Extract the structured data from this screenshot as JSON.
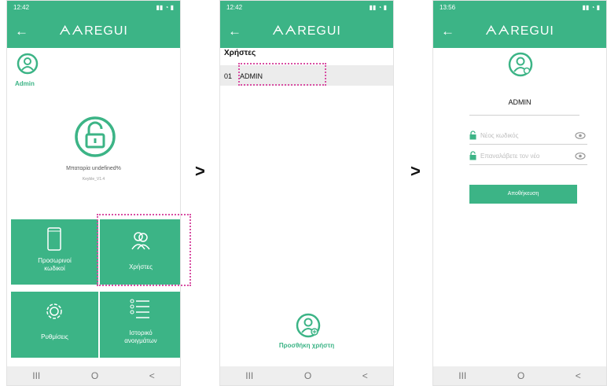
{
  "app": {
    "title": "ᗅᗅREGUI",
    "back_glyph": "←",
    "status_time_1": "12:42",
    "status_time_2": "12:42",
    "status_time_3": "13:56"
  },
  "step_arrows": [
    ">",
    ">"
  ],
  "screen1": {
    "user_label": "Admin",
    "status_text": "Μπαταρία undefined%",
    "version_text": "Keyble_V1.4",
    "tiles": {
      "temp_codes": "Προσωρινοί\nκωδικοί",
      "users": "Χρήστες",
      "settings": "Ρυθμίσεις",
      "history": "Ιστορικό\nανοιγμάτων"
    }
  },
  "screen2": {
    "section_title": "Χρήστες",
    "users": [
      {
        "number": "01",
        "name": "ADMIN"
      }
    ],
    "add_user_label": "Προσθήκη χρήστη"
  },
  "screen3": {
    "username": "ADMIN",
    "new_password_placeholder": "Νέος κωδικός",
    "repeat_password_placeholder": "Επαναλάβετε τον νέο",
    "save_label": "Αποθήκευση"
  },
  "nav": {
    "recents": "III",
    "home": "O",
    "back": "<"
  },
  "colors": {
    "accent": "#3cb486",
    "highlight": "#d84fa3"
  }
}
